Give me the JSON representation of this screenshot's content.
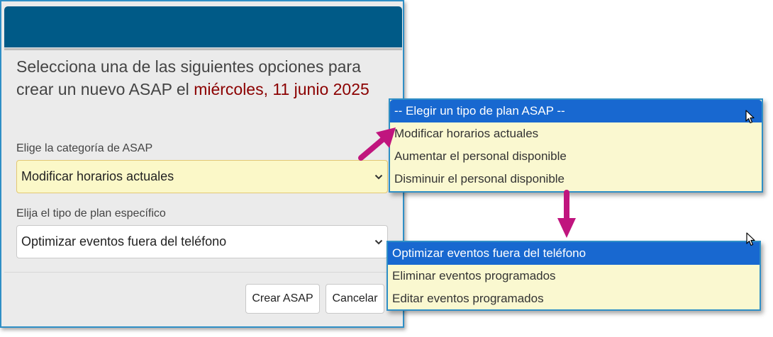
{
  "dialog": {
    "intro_text": "Selecciona una de las siguientes opciones para crear un nuevo ASAP el ",
    "intro_date": "miércoles, 11 junio 2025",
    "category_label": "Elige la categoría de ASAP",
    "category_value": "Modificar horarios actuales",
    "plan_label": "Elija el tipo de plan específico",
    "plan_value": "Optimizar eventos fuera del teléfono",
    "create_button": "Crear ASAP",
    "cancel_button": "Cancelar"
  },
  "dropdown_category": {
    "options": [
      "-- Elegir un tipo de plan ASAP --",
      "Modificar horarios actuales",
      "Aumentar el personal disponible",
      "Disminuir el personal disponible"
    ],
    "selected_index": 0
  },
  "dropdown_plan": {
    "options": [
      "Optimizar eventos fuera del teléfono",
      "Eliminar eventos programados",
      "Editar eventos programados"
    ],
    "selected_index": 0
  },
  "colors": {
    "header": "#005a87",
    "border_accent": "#2f8fc6",
    "date_text": "#8b0000",
    "highlight_field": "#fbf8c8",
    "selected_option": "#1868d0",
    "annotation_arrow": "#c0157e"
  },
  "icons": [
    "chevron-down-icon",
    "mouse-cursor-icon",
    "annotation-arrow-icon"
  ]
}
